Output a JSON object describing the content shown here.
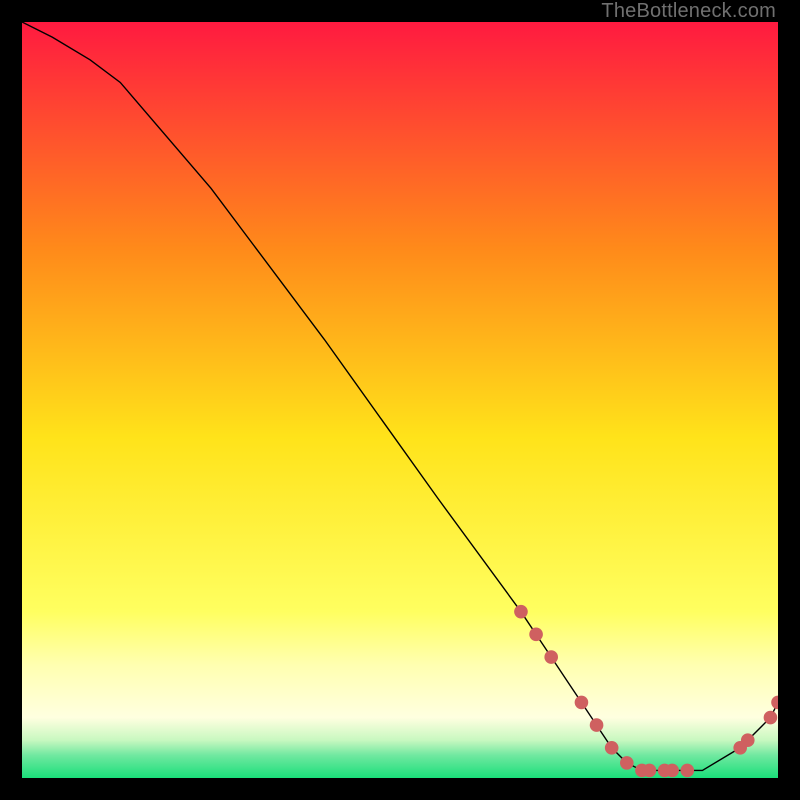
{
  "watermark": {
    "text": "TheBottleneck.com"
  },
  "colors": {
    "black": "#000000",
    "line": "#000000",
    "marker": "#cf6060",
    "grad_top": "#ff1a40",
    "grad_mid_upper": "#ff9a1a",
    "grad_mid": "#ffe31a",
    "grad_pale": "#ffff90",
    "grad_green_light": "#8ff0a0",
    "grad_green": "#1adf7a"
  },
  "chart_data": {
    "type": "line",
    "title": "",
    "xlabel": "",
    "ylabel": "",
    "xlim": [
      0,
      100
    ],
    "ylim": [
      0,
      100
    ],
    "x": [
      0,
      4,
      9,
      13,
      25,
      40,
      55,
      66,
      70,
      72,
      74,
      76,
      78,
      80,
      82,
      84,
      86,
      88,
      90,
      95,
      99,
      100
    ],
    "values": [
      100,
      98,
      95,
      92,
      78,
      58,
      37,
      22,
      16,
      13,
      10,
      7,
      4,
      2,
      1,
      1,
      1,
      1,
      1,
      4,
      8,
      10
    ],
    "markers": {
      "x": [
        66,
        68,
        70,
        74,
        76,
        78,
        80,
        82,
        83,
        85,
        86,
        88,
        95,
        96,
        99,
        100
      ],
      "y": [
        22,
        19,
        16,
        10,
        7,
        4,
        2,
        1,
        1,
        1,
        1,
        1,
        4,
        5,
        8,
        10
      ]
    }
  }
}
